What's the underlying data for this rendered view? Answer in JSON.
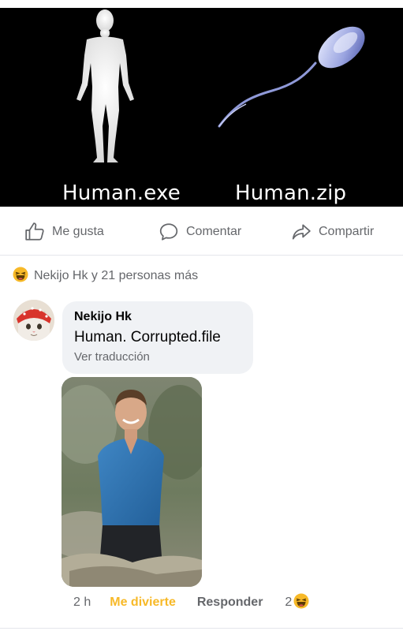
{
  "post": {
    "meme": {
      "left_caption": "Human.exe",
      "right_caption": "Human.zip",
      "left_figure": "human-silhouette",
      "right_figure": "sperm-cell"
    },
    "actions": {
      "like": "Me gusta",
      "comment": "Comentar",
      "share": "Compartir"
    },
    "reactions": {
      "icon": "laughing-emoji",
      "summary": "Nekijo Hk y 21 personas más"
    }
  },
  "comment": {
    "author": "Nekijo Hk",
    "text": "Human. Corrupted.file",
    "translate_label": "Ver traducción",
    "avatar": "cat-avatar",
    "photo": "man-in-blue-shirt-photo",
    "time": "2 h",
    "reaction_label": "Me divierte",
    "reply_label": "Responder",
    "reaction_count": "2",
    "reaction_icon": "laughing-emoji"
  },
  "colors": {
    "meme_background": "#000000",
    "muted_text": "#65676b",
    "haha_accent": "#f7b928",
    "bubble": "#f0f2f5"
  }
}
